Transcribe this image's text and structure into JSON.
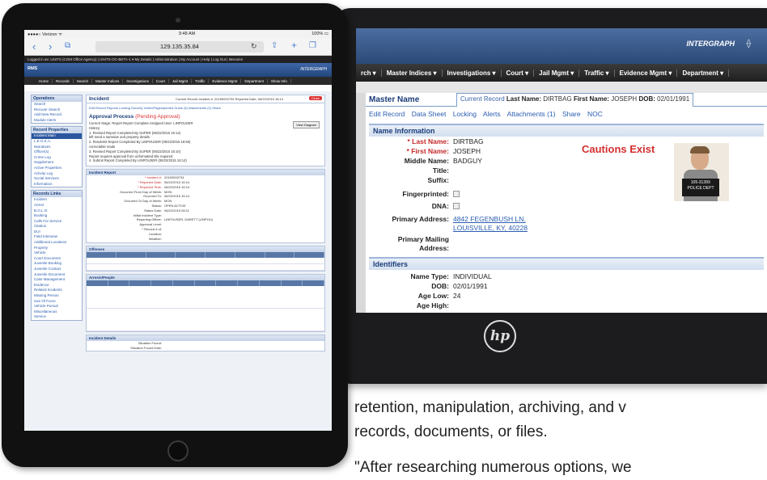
{
  "back_tablet": {
    "brand": "INTERGRAPH",
    "hp_logo": "hp",
    "nav": [
      "rch ▾",
      "Master Indices ▾",
      "Investigations ▾",
      "Court ▾",
      "Jail Mgmt ▾",
      "Traffic ▾",
      "Evidence Mgmt ▾",
      "Department ▾"
    ],
    "title": "Master Name",
    "current_record": {
      "label": "Current Record",
      "last_name_label": "Last Name:",
      "last_name": "DIRTBAG",
      "first_name_label": "First Name:",
      "first_name": "JOSEPH",
      "dob_label": "DOB:",
      "dob": "02/01/1991"
    },
    "links": [
      "Edit Record",
      "Data Sheet",
      "Locking",
      "Alerts",
      "Attachments (1)",
      "Share",
      "NOC"
    ],
    "name_info": {
      "header": "Name Information",
      "fields": [
        {
          "label": "* Last Name:",
          "value": "DIRTBAG",
          "required": true
        },
        {
          "label": "* First Name:",
          "value": "JOSEPH",
          "required": true
        },
        {
          "label": "Middle Name:",
          "value": "BADGUY"
        },
        {
          "label": "Title:",
          "value": ""
        },
        {
          "label": "Suffix:",
          "value": ""
        }
      ],
      "fingerprinted_label": "Fingerprinted:",
      "dna_label": "DNA:",
      "primary_address_label": "Primary Address:",
      "primary_address_line1": "4842 FEGENBUSH LN.",
      "primary_address_line2": "LOUISVILLE, KY, 40228",
      "mailing_label_1": "Primary Mailing",
      "mailing_label_2": "Address:"
    },
    "cautions": "Cautions Exist",
    "mugshot_board": "105-3128X\nPOLICE DEPT",
    "identifiers": {
      "header": "Identifiers",
      "fields": [
        {
          "label": "Name Type:",
          "value": "INDIVIDUAL"
        },
        {
          "label": "DOB:",
          "value": "02/01/1991"
        },
        {
          "label": "Age Low:",
          "value": "24"
        },
        {
          "label": "Age High:",
          "value": ""
        }
      ]
    }
  },
  "front_tablet": {
    "status_left": "●●●●○ Verizon ᯤ",
    "status_center": "9:48 AM",
    "status_right": "100% ▭",
    "url": "129.135.35.84",
    "appbar": "Logged in as: UNITS (COM Office Agency) | UNITS-OC-BETA-1 ▾      My Details  |  Administration  |  My Account  |  Help  |  Log Out  |  Menu/en",
    "brand_left": "RMS",
    "brand_right": "INTERGRAPH",
    "menu": [
      "Home",
      "Records",
      "Search",
      "Master Indices",
      "Investigations",
      "Court",
      "Jail Mgmt",
      "Traffic",
      "Evidence Mgmt",
      "Department",
      "Show Info"
    ],
    "sidebar": [
      {
        "header": "Operations",
        "items": [
          "Search",
          "Recover Search",
          "Add New Record",
          "Module Alerts"
        ]
      },
      {
        "header": "Record Properties",
        "items": [
          "Incident Main",
          "L.E.O.K.A.",
          "Narratives",
          "Officer(s)",
          "Crime Log",
          "Supplement",
          "Active Properties",
          "Activity Log",
          "Social Services",
          "Information"
        ],
        "active": 0
      },
      {
        "header": "Records Links",
        "items": [
          "Incident",
          "Arrest",
          "B.O.L.O.",
          "Booking",
          "Calls For Service",
          "Citation",
          "DUI",
          "Field Interview",
          "Additional Locations",
          "Property",
          "Vehicle",
          "Court Document",
          "Juvenile Booking",
          "Juvenile Contact",
          "Juvenile Document",
          "Case Management",
          "Evidence",
          "Related Incidents",
          "Missing Person",
          "Use Of Force",
          "Vehicle Pursuit",
          "Miscellaneous",
          "Service"
        ]
      }
    ],
    "incident": {
      "title": "Incident",
      "record_info": "Current Record  Incident #: 20150000734  Reported Date: 06/22/2015 16:14",
      "close": "Close",
      "links": "Edit Record   Reports   Locking   Security   Victim/Pages/printed   Guide (5)   Attachments (2)   Share",
      "approval_title": "Approval Process",
      "approval_pending": "(Pending Approval)",
      "approval_lines": [
        "Current Stage: Report Report  Complete  Assigned User: LINPOUSER",
        "History:",
        "1. Revised Report Completed By SUPER (06/22/2015 15:14)",
        "   left need a narrative and property details",
        "2. Resubmit Report Completed By LINPOUSER (06/22/2015 16:55)",
        "   correctable made",
        "3. Revised Report Completed By SUPER (06/22/2015 16:10)",
        "   Report requires approval from unformatted title required",
        "4. Submit Report Completed By LINPOUSER (06/22/2015 16:14)"
      ],
      "view_diagram": "View Diagram",
      "report_header": "Incident Report",
      "report_fields": [
        {
          "label": "* Incident #:",
          "value": "20150000734",
          "required": true
        },
        {
          "label": "* Reported Date:",
          "value": "06/22/2015 16:14",
          "required": true
        },
        {
          "label": "* Reported Time:",
          "value": "06/22/2015 16:14",
          "required": true
        },
        {
          "label": "Occurred From Day of Week:",
          "value": "MON"
        },
        {
          "label": "Occurred To:",
          "value": "06/22/2015 16:14"
        },
        {
          "label": "Occurred To Day of Week:",
          "value": "MON"
        },
        {
          "label": "Status:",
          "value": "OPEN ACTIVE"
        },
        {
          "label": "Status Date:",
          "value": "06/22/2015 08:11"
        },
        {
          "label": "Initial Incident Type:",
          "value": ""
        },
        {
          "label": "Reporting Officer:",
          "value": "LINPOUSER, DARETT (LINPOU)"
        },
        {
          "label": "Approval Level:",
          "value": ""
        },
        {
          "label": "* Record # of:",
          "value": ""
        },
        {
          "label": "Location:",
          "value": ""
        },
        {
          "label": "Weather:",
          "value": ""
        }
      ],
      "offenses_header": "Offenses",
      "arrests_header": "Arrests/People",
      "details_header": "Incident Details",
      "details_fields": [
        "Situation Found:",
        "Situation Found Date:"
      ]
    }
  },
  "article": {
    "line1": "retention, manipulation, archiving, and v",
    "line2": "records, documents, or files.",
    "line3": "\"After researching numerous options, we"
  }
}
